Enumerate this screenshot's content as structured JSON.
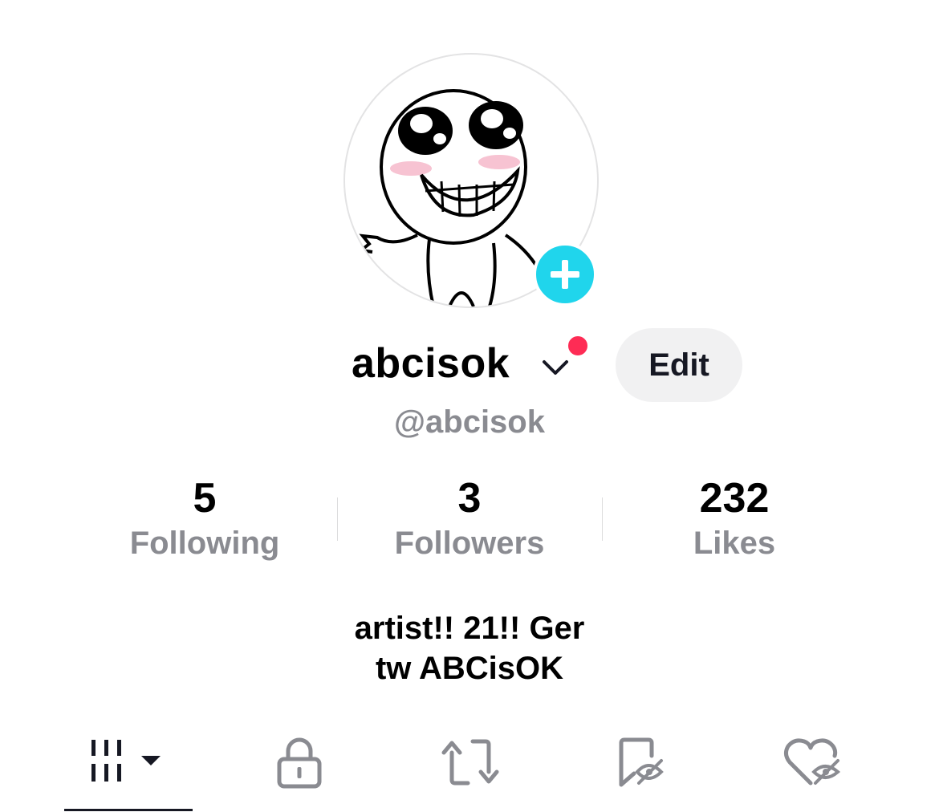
{
  "profile": {
    "display_name": "abcisok",
    "handle": "@abcisok",
    "edit_label": "Edit",
    "has_notification": true
  },
  "stats": [
    {
      "value": "5",
      "label": "Following"
    },
    {
      "value": "3",
      "label": "Followers"
    },
    {
      "value": "232",
      "label": "Likes"
    }
  ],
  "bio": {
    "line1": "artist!! 21!! Ger",
    "line2": "tw ABCisOK"
  },
  "tabs": [
    {
      "icon": "videos-grid-icon",
      "active": true
    },
    {
      "icon": "lock-icon",
      "active": false
    },
    {
      "icon": "repost-icon",
      "active": false
    },
    {
      "icon": "favorites-hidden-icon",
      "active": false
    },
    {
      "icon": "liked-hidden-icon",
      "active": false
    }
  ],
  "colors": {
    "add_badge": "#20d5ec",
    "notification_dot": "#fe2c55",
    "text_primary": "#000000",
    "text_secondary": "#8a8b91",
    "button_bg": "#f1f1f2",
    "icon_gray": "#8a8b91"
  }
}
